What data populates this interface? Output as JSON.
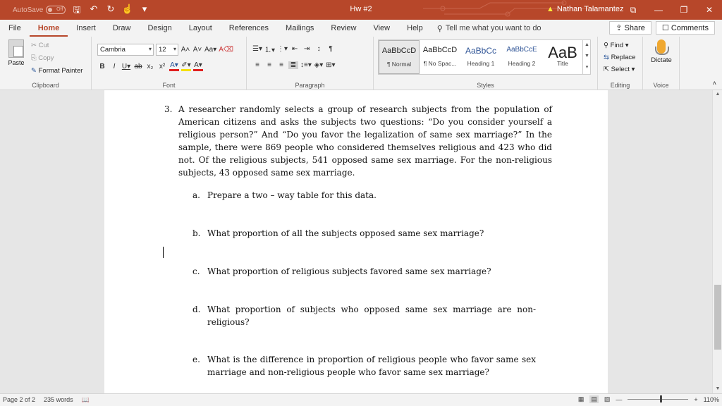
{
  "titlebar": {
    "autosave_label": "AutoSave",
    "autosave_state": "Off",
    "doc_title": "Hw #2",
    "user": "Nathan Talamantez"
  },
  "tabs": [
    {
      "label": "File"
    },
    {
      "label": "Home"
    },
    {
      "label": "Insert"
    },
    {
      "label": "Draw"
    },
    {
      "label": "Design"
    },
    {
      "label": "Layout"
    },
    {
      "label": "References"
    },
    {
      "label": "Mailings"
    },
    {
      "label": "Review"
    },
    {
      "label": "View"
    },
    {
      "label": "Help"
    }
  ],
  "tellme": "Tell me what you want to do",
  "share_label": "Share",
  "comments_label": "Comments",
  "ribbon": {
    "clipboard": {
      "paste": "Paste",
      "cut": "Cut",
      "copy": "Copy",
      "format_painter": "Format Painter",
      "label": "Clipboard"
    },
    "font": {
      "family": "Cambria",
      "size": "12",
      "label": "Font"
    },
    "paragraph": {
      "label": "Paragraph"
    },
    "styles": {
      "label": "Styles",
      "items": [
        {
          "sample": "AaBbCcD",
          "name": "¶ Normal"
        },
        {
          "sample": "AaBbCcD",
          "name": "¶ No Spac..."
        },
        {
          "sample": "AaBbCc",
          "name": "Heading 1"
        },
        {
          "sample": "AaBbCcE",
          "name": "Heading 2"
        },
        {
          "sample": "AaB",
          "name": "Title"
        }
      ]
    },
    "editing": {
      "find": "Find",
      "replace": "Replace",
      "select": "Select",
      "label": "Editing"
    },
    "voice": {
      "dictate": "Dictate",
      "label": "Voice"
    }
  },
  "document": {
    "question_number": "3.",
    "question_text": "A researcher randomly selects a group of research subjects from the population of American citizens and asks the subjects two questions: “Do you consider yourself a religious person?” And “Do you favor the legalization of same sex marriage?” In the sample, there were 869 people who considered themselves religious and 423 who did not. Of the religious subjects, 541 opposed same sex marriage. For the non-religious subjects, 43 opposed same sex marriage.",
    "subquestions": [
      {
        "label": "a.",
        "text": "Prepare a two – way table for this data."
      },
      {
        "label": "b.",
        "text": "What proportion of all the subjects opposed same sex marriage?"
      },
      {
        "label": "c.",
        "text": "What proportion of religious subjects favored same sex marriage?"
      },
      {
        "label": "d.",
        "text": "What proportion of subjects who opposed same sex marriage are non-religious?"
      },
      {
        "label": "e.",
        "text": "What is the difference in proportion of religious people who favor same sex marriage and non-religious people who favor same sex marriage?"
      }
    ]
  },
  "status": {
    "page": "Page 2 of 2",
    "words": "235 words",
    "zoom": "110%"
  }
}
